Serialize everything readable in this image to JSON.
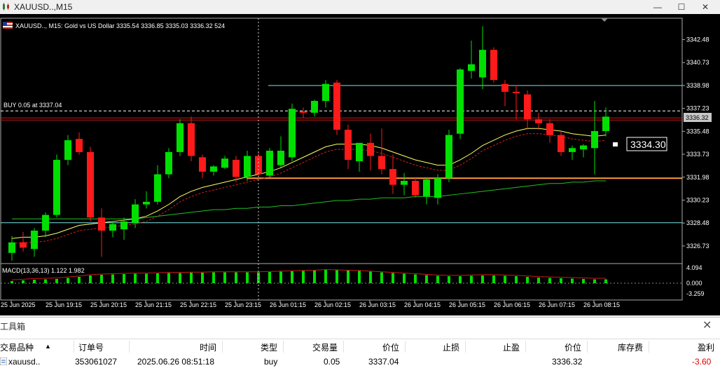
{
  "window": {
    "title": "XAUUSD..,M15",
    "buttons": [
      "—",
      "☐",
      "✕"
    ]
  },
  "chart_info": {
    "text": "XAUUSD.., M15:  Gold vs US Dollar  3335.54 3336.85 3335.03 3336.32  524"
  },
  "order_line": {
    "label": "BUY 0.05 at 3337.04",
    "price": 3337.04
  },
  "price_tag": "3334.30",
  "current_price_label": "3336.32",
  "y_ticks": [
    "3342.48",
    "3340.73",
    "3338.98",
    "3337.23",
    "3335.48",
    "3333.73",
    "3331.98",
    "3330.23",
    "3328.48",
    "3326.73"
  ],
  "macd": {
    "label": "MACD(13,36,13) 1.122 1.982",
    "ticks": [
      "4.094",
      "0.000",
      "-3.259"
    ]
  },
  "x_ticks": [
    "25 Jun 2025",
    "25 Jun 19:15",
    "25 Jun 20:15",
    "25 Jun 21:15",
    "25 Jun 22:15",
    "25 Jun 23:15",
    "26 Jun 01:15",
    "26 Jun 02:15",
    "26 Jun 03:15",
    "26 Jun 04:15",
    "26 Jun 05:15",
    "26 Jun 06:15",
    "26 Jun 07:15",
    "26 Jun 08:15"
  ],
  "colors": {
    "bull": "#00e000",
    "bear": "#ff1a1a",
    "fast_ma": "#ffff66",
    "slow_ma": "#22c022",
    "hline_cyan": "#7fe6e6",
    "hline_orange": "#ff9a3c"
  },
  "chart_data": {
    "type": "candlestick",
    "ylim": [
      3325.6,
      3343.9
    ],
    "candles": [
      {
        "o": 3326.2,
        "h": 3327.5,
        "l": 3325.6,
        "c": 3327.0
      },
      {
        "o": 3327.0,
        "h": 3327.8,
        "l": 3326.3,
        "c": 3326.6
      },
      {
        "o": 3326.5,
        "h": 3328.1,
        "l": 3325.9,
        "c": 3327.9
      },
      {
        "o": 3327.9,
        "h": 3329.3,
        "l": 3327.4,
        "c": 3329.1
      },
      {
        "o": 3329.1,
        "h": 3333.7,
        "l": 3328.9,
        "c": 3333.3
      },
      {
        "o": 3333.3,
        "h": 3335.2,
        "l": 3332.9,
        "c": 3334.8
      },
      {
        "o": 3334.9,
        "h": 3335.4,
        "l": 3333.7,
        "c": 3333.9
      },
      {
        "o": 3333.9,
        "h": 3334.3,
        "l": 3328.6,
        "c": 3328.9
      },
      {
        "o": 3328.9,
        "h": 3329.6,
        "l": 3325.9,
        "c": 3327.9
      },
      {
        "o": 3327.9,
        "h": 3328.6,
        "l": 3327.4,
        "c": 3328.4
      },
      {
        "o": 3328.0,
        "h": 3328.9,
        "l": 3327.2,
        "c": 3328.6
      },
      {
        "o": 3328.5,
        "h": 3330.3,
        "l": 3328.1,
        "c": 3329.9
      },
      {
        "o": 3329.9,
        "h": 3330.9,
        "l": 3329.6,
        "c": 3330.1
      },
      {
        "o": 3330.1,
        "h": 3332.9,
        "l": 3329.9,
        "c": 3332.2
      },
      {
        "o": 3332.2,
        "h": 3334.2,
        "l": 3331.9,
        "c": 3333.9
      },
      {
        "o": 3333.9,
        "h": 3336.4,
        "l": 3333.6,
        "c": 3336.1
      },
      {
        "o": 3336.1,
        "h": 3336.6,
        "l": 3333.2,
        "c": 3333.6
      },
      {
        "o": 3333.5,
        "h": 3333.7,
        "l": 3331.9,
        "c": 3332.4
      },
      {
        "o": 3332.4,
        "h": 3332.9,
        "l": 3332.1,
        "c": 3332.8
      },
      {
        "o": 3332.7,
        "h": 3333.6,
        "l": 3332.6,
        "c": 3333.4
      },
      {
        "o": 3333.3,
        "h": 3333.6,
        "l": 3331.6,
        "c": 3332.0
      },
      {
        "o": 3332.0,
        "h": 3334.0,
        "l": 3331.7,
        "c": 3333.6
      },
      {
        "o": 3333.6,
        "h": 3333.9,
        "l": 3331.9,
        "c": 3332.2
      },
      {
        "o": 3332.1,
        "h": 3334.2,
        "l": 3331.9,
        "c": 3334.0
      },
      {
        "o": 3332.9,
        "h": 3335.1,
        "l": 3332.7,
        "c": 3334.0
      },
      {
        "o": 3333.5,
        "h": 3337.6,
        "l": 3333.2,
        "c": 3337.2
      },
      {
        "o": 3337.0,
        "h": 3337.3,
        "l": 3336.5,
        "c": 3336.9
      },
      {
        "o": 3336.9,
        "h": 3337.9,
        "l": 3336.6,
        "c": 3337.8
      },
      {
        "o": 3337.8,
        "h": 3339.4,
        "l": 3337.3,
        "c": 3339.1
      },
      {
        "o": 3339.2,
        "h": 3339.4,
        "l": 3335.2,
        "c": 3335.6
      },
      {
        "o": 3335.6,
        "h": 3336.0,
        "l": 3332.6,
        "c": 3333.3
      },
      {
        "o": 3333.2,
        "h": 3334.6,
        "l": 3332.4,
        "c": 3334.6
      },
      {
        "o": 3334.6,
        "h": 3335.3,
        "l": 3332.5,
        "c": 3333.6
      },
      {
        "o": 3333.6,
        "h": 3335.7,
        "l": 3332.2,
        "c": 3332.6
      },
      {
        "o": 3332.6,
        "h": 3333.7,
        "l": 3330.7,
        "c": 3331.4
      },
      {
        "o": 3331.4,
        "h": 3332.3,
        "l": 3330.6,
        "c": 3331.7
      },
      {
        "o": 3331.7,
        "h": 3332.0,
        "l": 3330.4,
        "c": 3330.6
      },
      {
        "o": 3330.5,
        "h": 3331.9,
        "l": 3329.9,
        "c": 3331.8
      },
      {
        "o": 3330.4,
        "h": 3332.2,
        "l": 3329.9,
        "c": 3331.9
      },
      {
        "o": 3331.9,
        "h": 3335.6,
        "l": 3331.6,
        "c": 3335.2
      },
      {
        "o": 3335.3,
        "h": 3340.3,
        "l": 3334.9,
        "c": 3340.2
      },
      {
        "o": 3340.1,
        "h": 3342.4,
        "l": 3339.5,
        "c": 3340.6
      },
      {
        "o": 3339.6,
        "h": 3343.5,
        "l": 3338.7,
        "c": 3341.7
      },
      {
        "o": 3341.7,
        "h": 3341.9,
        "l": 3339.2,
        "c": 3339.4
      },
      {
        "o": 3339.1,
        "h": 3339.4,
        "l": 3337.4,
        "c": 3338.5
      },
      {
        "o": 3338.5,
        "h": 3339.0,
        "l": 3336.4,
        "c": 3338.4
      },
      {
        "o": 3338.3,
        "h": 3338.6,
        "l": 3335.6,
        "c": 3336.4
      },
      {
        "o": 3336.4,
        "h": 3336.9,
        "l": 3335.6,
        "c": 3336.1
      },
      {
        "o": 3336.1,
        "h": 3336.4,
        "l": 3334.6,
        "c": 3335.2
      },
      {
        "o": 3335.2,
        "h": 3335.5,
        "l": 3333.6,
        "c": 3333.9
      },
      {
        "o": 3333.9,
        "h": 3334.4,
        "l": 3333.3,
        "c": 3334.2
      },
      {
        "o": 3334.1,
        "h": 3334.5,
        "l": 3333.5,
        "c": 3334.4
      },
      {
        "o": 3334.2,
        "h": 3337.8,
        "l": 3332.2,
        "c": 3335.5
      },
      {
        "o": 3335.5,
        "h": 3337.3,
        "l": 3335.1,
        "c": 3336.6
      }
    ],
    "fast_ma": [
      3327.3,
      3327.4,
      3327.4,
      3327.5,
      3327.7,
      3328.0,
      3328.3,
      3328.4,
      3328.5,
      3328.6,
      3328.7,
      3328.8,
      3329.0,
      3329.4,
      3329.9,
      3330.5,
      3330.9,
      3331.2,
      3331.4,
      3331.6,
      3331.8,
      3332.0,
      3332.2,
      3332.4,
      3332.7,
      3333.1,
      3333.5,
      3333.9,
      3334.3,
      3334.5,
      3334.5,
      3334.5,
      3334.4,
      3334.2,
      3333.9,
      3333.6,
      3333.3,
      3333.1,
      3332.9,
      3332.9,
      3333.3,
      3333.8,
      3334.4,
      3334.8,
      3335.2,
      3335.5,
      3335.7,
      3335.7,
      3335.6,
      3335.5,
      3335.3,
      3335.2,
      3335.1,
      3335.2
    ],
    "slow_ma": [
      3328.8,
      3328.8,
      3328.8,
      3328.8,
      3328.8,
      3328.8,
      3328.8,
      3328.8,
      3328.8,
      3328.8,
      3328.8,
      3328.8,
      3328.9,
      3329.0,
      3329.1,
      3329.2,
      3329.3,
      3329.4,
      3329.5,
      3329.5,
      3329.6,
      3329.6,
      3329.7,
      3329.7,
      3329.8,
      3329.8,
      3329.9,
      3330.0,
      3330.1,
      3330.2,
      3330.2,
      3330.3,
      3330.3,
      3330.4,
      3330.4,
      3330.4,
      3330.5,
      3330.5,
      3330.5,
      3330.6,
      3330.7,
      3330.8,
      3330.9,
      3331.0,
      3331.1,
      3331.2,
      3331.3,
      3331.4,
      3331.5,
      3331.5,
      3331.6,
      3331.6,
      3331.7,
      3331.7
    ],
    "macd_hist": [
      0.6,
      0.8,
      1.0,
      1.1,
      1.2,
      1.5,
      1.8,
      2.2,
      2.4,
      2.5,
      2.6,
      2.7,
      2.7,
      2.8,
      2.9,
      2.9,
      3.0,
      3.0,
      3.1,
      3.1,
      3.1,
      3.1,
      3.1,
      3.2,
      3.3,
      3.4,
      3.5,
      3.6,
      3.8,
      3.7,
      3.6,
      3.5,
      3.3,
      3.1,
      2.9,
      2.7,
      2.5,
      2.3,
      2.1,
      2.0,
      2.0,
      2.1,
      2.2,
      2.2,
      2.1,
      2.0,
      1.8,
      1.6,
      1.5,
      1.4,
      1.3,
      1.2,
      1.1,
      1.1
    ],
    "hlines": {
      "cyan_top": 3338.98,
      "red": 3336.5,
      "orange": 3331.9,
      "cyan_bottom": 3328.5
    }
  },
  "toolbox": {
    "title": "工具箱",
    "columns": [
      "交易品种",
      "订单号",
      "时间",
      "类型",
      "交易量",
      "价位",
      "止损",
      "止盈",
      "价位",
      "库存费",
      "盈利"
    ],
    "row": {
      "symbol": "xauusd..",
      "ticket": "353061027",
      "time": "2025.06.26 08:51:18",
      "type": "buy",
      "volume": "0.05",
      "open_price": "3337.04",
      "sl": "",
      "tp": "",
      "price": "3336.32",
      "swap": "",
      "profit": "-3.60"
    }
  }
}
